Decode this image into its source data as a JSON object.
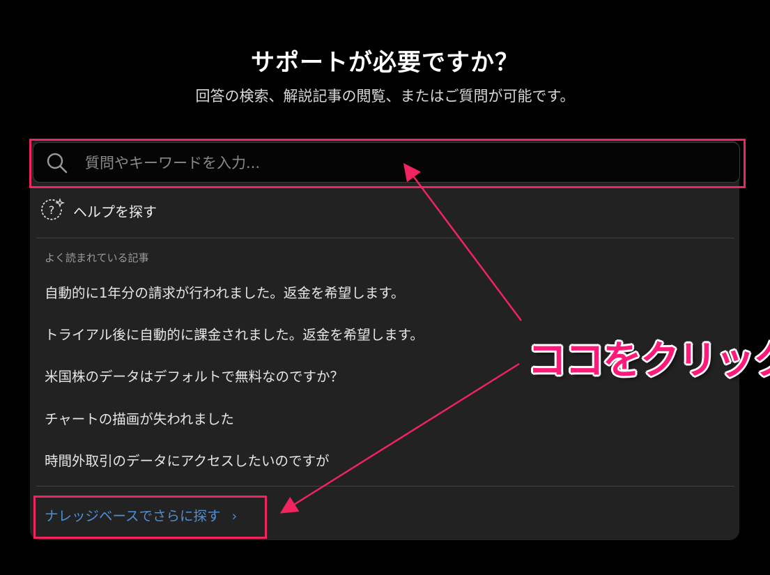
{
  "header": {
    "title": "サポートが必要ですか？",
    "subtitle": "回答の検索、解説記事の閲覧、またはご質問が可能です。"
  },
  "search": {
    "placeholder": "質問やキーワードを入力..."
  },
  "help": {
    "label": "ヘルプを探す",
    "icon": "help-sparkle-icon"
  },
  "popular": {
    "heading": "よく読まれている記事",
    "articles": [
      "自動的に1年分の請求が行われました。返金を希望します。",
      "トライアル後に自動的に課金されました。返金を希望します。",
      "米国株のデータはデフォルトで無料なのですか？",
      "チャートの描画が失われました",
      "時間外取引のデータにアクセスしたいのですが"
    ]
  },
  "knowledge_base": {
    "label": "ナレッジベースでさらに探す",
    "chevron": "›"
  },
  "annotation": {
    "callout": "ココをクリック",
    "color": "#f0245e"
  },
  "colors": {
    "background": "#000000",
    "panel": "#222222",
    "link": "#4f8fd6"
  }
}
